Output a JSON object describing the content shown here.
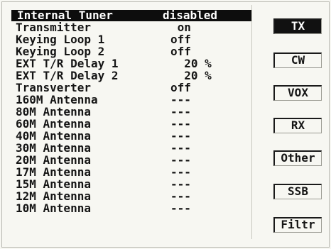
{
  "menu": {
    "rows": [
      {
        "label": "Internal Tuner",
        "value": "disabled"
      },
      {
        "label": "Transmitter",
        "value": " on"
      },
      {
        "label": "Keying Loop 1",
        "value": "off"
      },
      {
        "label": "Keying Loop 2",
        "value": "off"
      },
      {
        "label": "EXT T/R Delay 1",
        "value": "  20 %"
      },
      {
        "label": "EXT T/R Delay 2",
        "value": "  20 %"
      },
      {
        "label": "Transverter",
        "value": "off"
      },
      {
        "label": "160M Antenna",
        "value": "---"
      },
      {
        "label": "80M Antenna",
        "value": "---"
      },
      {
        "label": "60M Antenna",
        "value": "---"
      },
      {
        "label": "40M Antenna",
        "value": "---"
      },
      {
        "label": "30M Antenna",
        "value": "---"
      },
      {
        "label": "20M Antenna",
        "value": "---"
      },
      {
        "label": "17M Antenna",
        "value": "---"
      },
      {
        "label": "15M Antenna",
        "value": "---"
      },
      {
        "label": "12M Antenna",
        "value": "---"
      },
      {
        "label": "10M Antenna",
        "value": "---"
      }
    ]
  },
  "softkeys": {
    "tx": "TX",
    "cw": "CW",
    "vox": "VOX",
    "rx": "RX",
    "other": "Other",
    "ssb": "SSB",
    "filtr": "Filtr"
  }
}
